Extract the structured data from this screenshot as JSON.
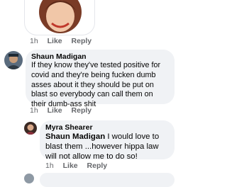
{
  "top_comment": {
    "meta": {
      "time": "1h",
      "like": "Like",
      "reply": "Reply"
    }
  },
  "comment1": {
    "author": "Shaun Madigan",
    "text": "If they know they've tested positive for covid and they're being fucken dumb asses about it they should be put on blast so everybody can call them on their dumb-ass shit",
    "meta": {
      "time": "1h",
      "like": "Like",
      "reply": "Reply"
    }
  },
  "reply1": {
    "author": "Myra Shearer",
    "tag": "Shaun Madigan",
    "text": " I would love to blast them ...however hippa law will not allow me to do so!",
    "meta": {
      "time": "1h",
      "like": "Like",
      "reply": "Reply"
    }
  },
  "icons": {
    "sticker": "memoji-sticker-icon",
    "avatar1": "shaun-madigan-avatar",
    "avatar2": "myra-shearer-avatar"
  }
}
